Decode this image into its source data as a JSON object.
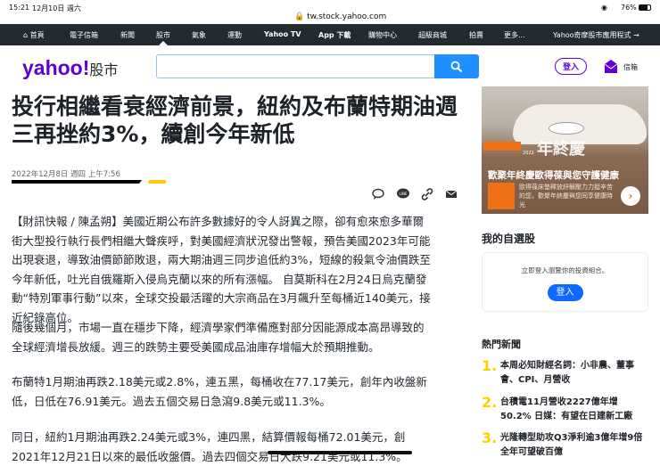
{
  "status_bar": {
    "time": "15:21",
    "date": "12月10日 週六",
    "battery": "76%",
    "url": "tw.stock.yahoo.com"
  },
  "nav": [
    {
      "label": "首頁",
      "icon": "home-icon"
    },
    {
      "label": "電子信箱"
    },
    {
      "label": "新聞"
    },
    {
      "label": "股市",
      "active": true
    },
    {
      "label": "氣象"
    },
    {
      "label": "運動"
    },
    {
      "label": "Yahoo TV"
    },
    {
      "label": "App 下載"
    },
    {
      "label": "購物中心"
    },
    {
      "label": "超級商城"
    },
    {
      "label": "拍賣"
    },
    {
      "label": "更多..."
    },
    {
      "label": "Yahoo奇摩股市應用程式 →"
    }
  ],
  "header": {
    "logo": "yahoo!",
    "logo_section": "股市",
    "search_placeholder": "",
    "login": "登入",
    "mail": "信箱"
  },
  "article": {
    "title": "投行相繼看衰經濟前景，紐約及布蘭特期油週三再挫約3%，續創今年新低",
    "date": "2022年12月8日 週四 上午7:56",
    "paragraphs": [
      "【財訊快報 / 陳孟朔】美國近期公布許多數據好的令人訝異之際，卻有愈來愈多華爾街大型投行執行長們相繼大聲疾呼，對美國經濟狀況發出警報，預告美國2023年可能出現衰退，導致油價節節敗退，兩大期油週三同步追低約3%，短線的殺氣令油價跌至今年新低，吐光自俄羅斯入侵烏克蘭以來的所有漲幅。 自莫斯科在2月24日烏克蘭發動“特別軍事行動”以來，全球交投最活躍的大宗商品在3月飆升至每桶近140美元，接近紀錄高位。",
      "隨後幾個月，市場一直在穩步下降，經濟學家們準備應對部分因能源成本高昂導致的全球經濟增長放緩。週三的跌勢主要受美國成品油庫存增幅大於預期推動。",
      "布蘭特1月期油再跌2.18美元或2.8%，連五黑，每桶收在77.17美元，創年內收盤新低，日低在76.91美元。過去五個交易日急瀉9.8美元或11.3%。",
      "同日，紐約1月期油再跌2.24美元或3%，連四黑，結算價報每桶72.01美元，創2021年12月21日以來的最低收盤價。過去四個交易日大跌9.21美元或11.3%。"
    ]
  },
  "ad": {
    "brand_year": "2022",
    "campaign": "年終慶",
    "headline": "歡聚年終慶歐得葆與您守護健康",
    "text": "歐得葆床墊釋放紓解壓力力挺辛苦的您，歡聚年終慶與您同享健康時光"
  },
  "watchlist": {
    "title": "我的自選股",
    "prompt": "立即登入瀏覽你的投資組合。",
    "login": "登入"
  },
  "hot_news": {
    "title": "熱門新聞",
    "items": [
      {
        "rank": "1.",
        "text": "本周必知財經名詞：小非農、董事會、CPI、月營收"
      },
      {
        "rank": "2.",
        "text": "台積電11月營收2227億年增50.2% 日媒：有望在日建新工廠"
      },
      {
        "rank": "3.",
        "text": "光隆轉型助攻Q3淨利逾3億年增9倍　全年可望破百億"
      }
    ]
  },
  "colors": {
    "brand": "#6001d2",
    "nav_bg": "#232a31",
    "search_blue": "#1e90ff",
    "rank_yellow": "#ffd000"
  }
}
